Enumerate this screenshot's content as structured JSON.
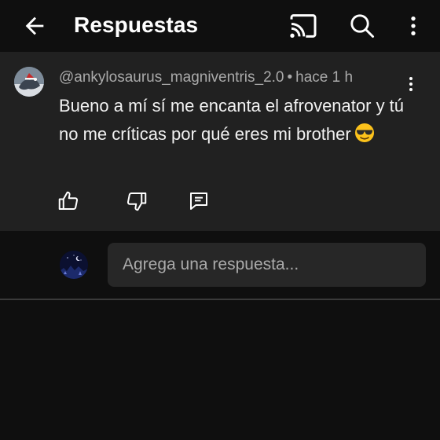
{
  "header": {
    "title": "Respuestas",
    "icons": [
      "arrow-back-icon",
      "cast-icon",
      "search-icon",
      "more-vert-icon"
    ]
  },
  "comment": {
    "author": "@ankylosaurus_magniventris_2.0",
    "separator": "•",
    "time": "hace 1 h",
    "text": "Bueno a mí sí me encanta el afrovenator y tú no me críticas por qué eres mi brother",
    "emoji": "smiling-face-with-sunglasses",
    "actions": [
      "thumb-up-icon",
      "thumb-down-icon",
      "reply-comment-icon"
    ]
  },
  "reply": {
    "placeholder": "Agrega una respuesta..."
  },
  "colors": {
    "background": "#0f0f0f",
    "card": "#212121",
    "input": "#272727",
    "text": "#f1f1f1",
    "secondary_text": "#aaaaaa"
  }
}
